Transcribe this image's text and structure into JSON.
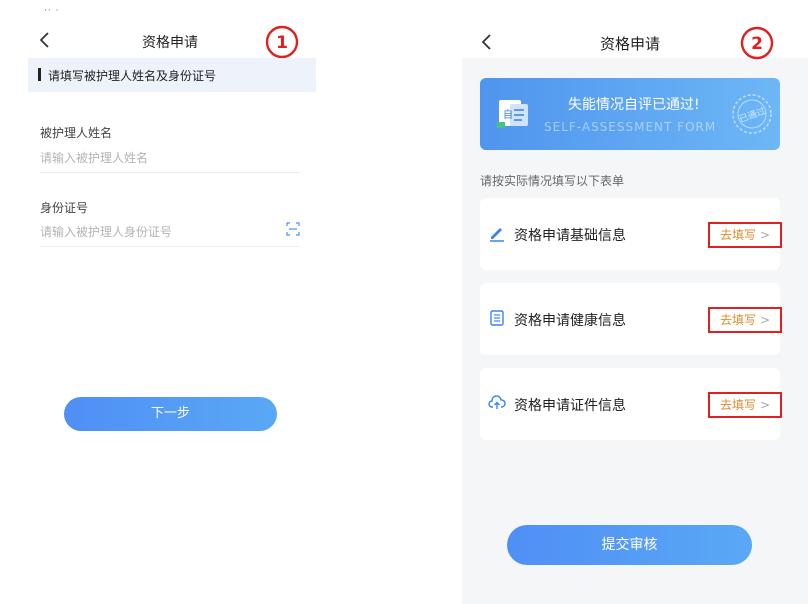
{
  "screen1": {
    "top_mark": "·· ·",
    "title": "资格申请",
    "step_badge": "①",
    "hint": "请填写被护理人姓名及身份证号",
    "fields": [
      {
        "label": "被护理人姓名",
        "placeholder": "请输入被护理人姓名"
      },
      {
        "label": "身份证号",
        "placeholder": "请输入被护理人身份证号"
      }
    ],
    "next_label": "下一步"
  },
  "screen2": {
    "title": "资格申请",
    "step_badge": "②",
    "banner_title": "失能情况自评已通过!",
    "banner_subtitle": "SELF-ASSESSMENT FORM",
    "banner_icon_text": "自",
    "stamp_text": "已通过",
    "prompt": "请按实际情况填写以下表单",
    "cards": [
      {
        "label": "资格申请基础信息",
        "action": "去填写",
        "icon": "pen-icon"
      },
      {
        "label": "资格申请健康信息",
        "action": "去填写",
        "icon": "document-icon"
      },
      {
        "label": "资格申请证件信息",
        "action": "去填写",
        "icon": "cloud-upload-icon"
      }
    ],
    "chevron": ">",
    "submit_label": "提交审核"
  },
  "colors": {
    "accent": "#4f8ff5",
    "highlight_border": "#e02020",
    "action_text": "#e08a2a"
  }
}
